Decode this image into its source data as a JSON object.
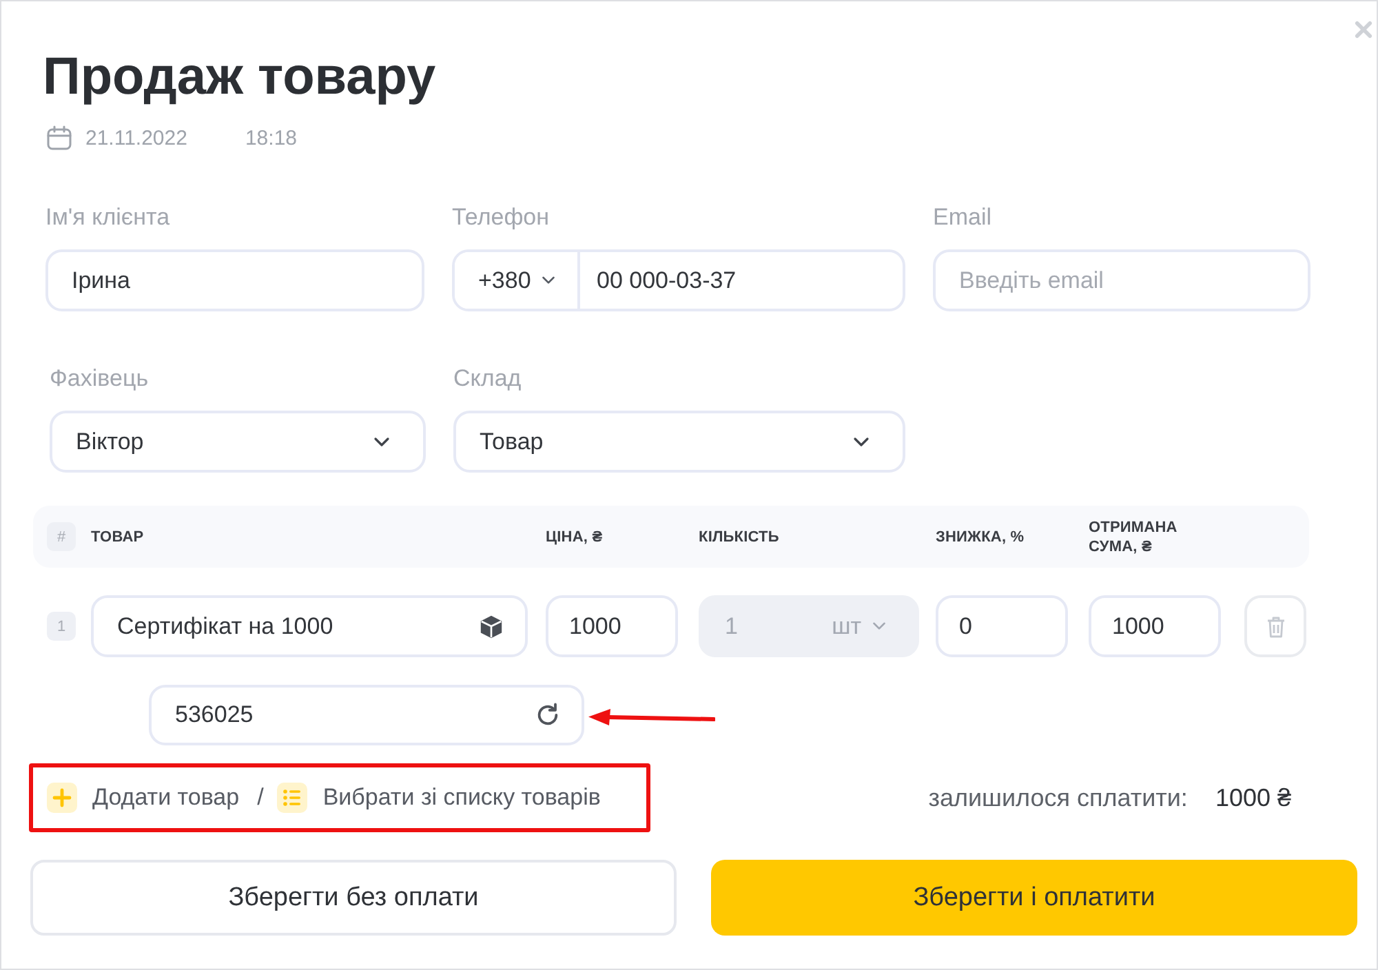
{
  "window": {
    "title": "Продаж товару",
    "date": "21.11.2022",
    "time": "18:18"
  },
  "client_fields": [
    {
      "kind": "text",
      "label": "Ім'я клієнта",
      "value": "Ірина"
    },
    {
      "kind": "phone",
      "label": "Телефон",
      "country_code": "+380",
      "value": "00 000-03-37"
    },
    {
      "kind": "text",
      "label": "Email",
      "placeholder": "Введіть email"
    }
  ],
  "assignment_fields": [
    {
      "label": "Фахівець",
      "value": "Віктор"
    },
    {
      "label": "Склад",
      "value": "Товар"
    }
  ],
  "table": {
    "number_header": "#",
    "columns": [
      "ТОВАР",
      "ЦІНА, ₴",
      "КІЛЬКІСТЬ",
      "ЗНИЖКА, %",
      "ОТРИМАНА СУМА, ₴"
    ],
    "rows": [
      {
        "number": "1",
        "product": "Сертифікат на 1000",
        "price": "1000",
        "quantity": "1",
        "unit": "шт",
        "quantity_disabled": true,
        "discount": "0",
        "sum": "1000",
        "code": "536025"
      }
    ]
  },
  "add_actions": {
    "items": [
      {
        "kind": "add",
        "label": "Додати товар"
      },
      {
        "kind": "list",
        "label": "Вибрати зі списку товарів"
      }
    ],
    "separator": "/"
  },
  "balance": {
    "label": "залишилося сплатити:",
    "amount": "1000 ₴"
  },
  "buttons": [
    {
      "kind": "secondary",
      "label": "Зберегти без оплати"
    },
    {
      "kind": "primary",
      "label": "Зберегти і оплатити"
    }
  ],
  "annotations": {
    "frame_around_add_actions": true,
    "arrow_to_code_field": true
  }
}
